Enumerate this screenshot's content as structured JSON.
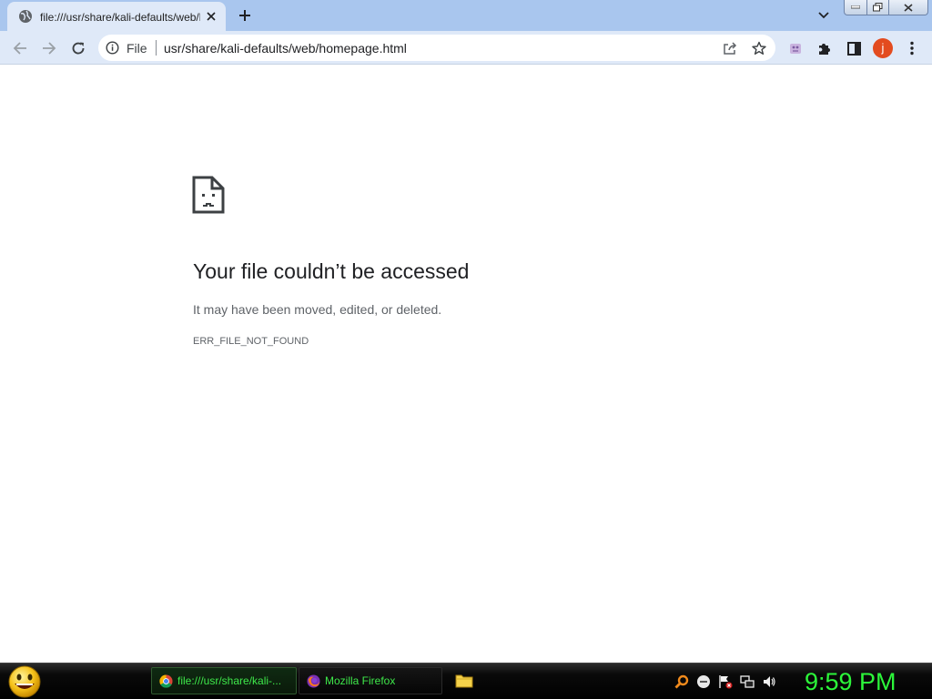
{
  "tab": {
    "title": "file:///usr/share/kali-defaults/web/homepage.html"
  },
  "omnibox": {
    "scheme_label": "File",
    "url": "usr/share/kali-defaults/web/homepage.html"
  },
  "profile": {
    "initial": "j",
    "color": "#e34b1f"
  },
  "error": {
    "title": "Your file couldn’t be accessed",
    "description": "It may have been moved, edited, or deleted.",
    "code": "ERR_FILE_NOT_FOUND"
  },
  "taskbar": {
    "tasks": [
      {
        "label": "file:///usr/share/kali-...",
        "icon": "chrome-icon",
        "active": true
      },
      {
        "label": "Mozilla Firefox",
        "icon": "firefox-icon",
        "active": false
      }
    ],
    "clock": "9:59 PM",
    "clock_color": "#2cf53a"
  },
  "colors": {
    "tabstrip": "#a9c6ee",
    "toolbar": "#dfe9f8"
  }
}
